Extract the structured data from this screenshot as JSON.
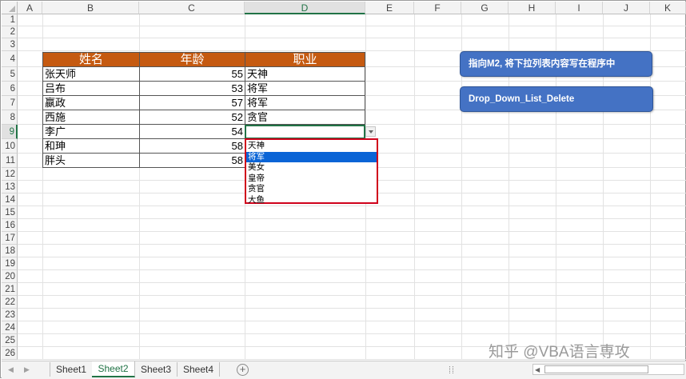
{
  "columns": [
    "A",
    "B",
    "C",
    "D",
    "E",
    "F",
    "G",
    "H",
    "I",
    "J",
    "K"
  ],
  "rows": [
    "1",
    "2",
    "3",
    "4",
    "5",
    "6",
    "7",
    "8",
    "9",
    "10",
    "11",
    "12",
    "13",
    "14",
    "15",
    "16",
    "17",
    "18",
    "19",
    "20",
    "21",
    "22",
    "23",
    "24",
    "25",
    "26"
  ],
  "table": {
    "headers": [
      "姓名",
      "年龄",
      "职业"
    ],
    "rows": [
      {
        "name": "张天师",
        "age": "55",
        "job": "天神"
      },
      {
        "name": "吕布",
        "age": "53",
        "job": "将军"
      },
      {
        "name": "嬴政",
        "age": "57",
        "job": "将军"
      },
      {
        "name": "西施",
        "age": "52",
        "job": "贪官"
      },
      {
        "name": "李广",
        "age": "54",
        "job": ""
      },
      {
        "name": "和珅",
        "age": "58",
        "job": ""
      },
      {
        "name": "胖头",
        "age": "58",
        "job": ""
      }
    ]
  },
  "dropdown": {
    "options": [
      "天神",
      "将军",
      "美女",
      "皇帝",
      "贪官",
      "大鱼"
    ],
    "highlighted": "将军"
  },
  "buttons": {
    "button1": "指向M2, 将下拉列表内容写在程序中",
    "button2": "Drop_Down_List_Delete"
  },
  "sheets": [
    "Sheet1",
    "Sheet2",
    "Sheet3",
    "Sheet4"
  ],
  "active_sheet": "Sheet2",
  "watermark": "知乎 @VBA语言専攻",
  "colors": {
    "header_fill": "#c55a11",
    "button_fill": "#4472c4",
    "selection": "#217346",
    "dropdown_highlight": "#0a64d6",
    "dropdown_border": "#d0021b"
  }
}
